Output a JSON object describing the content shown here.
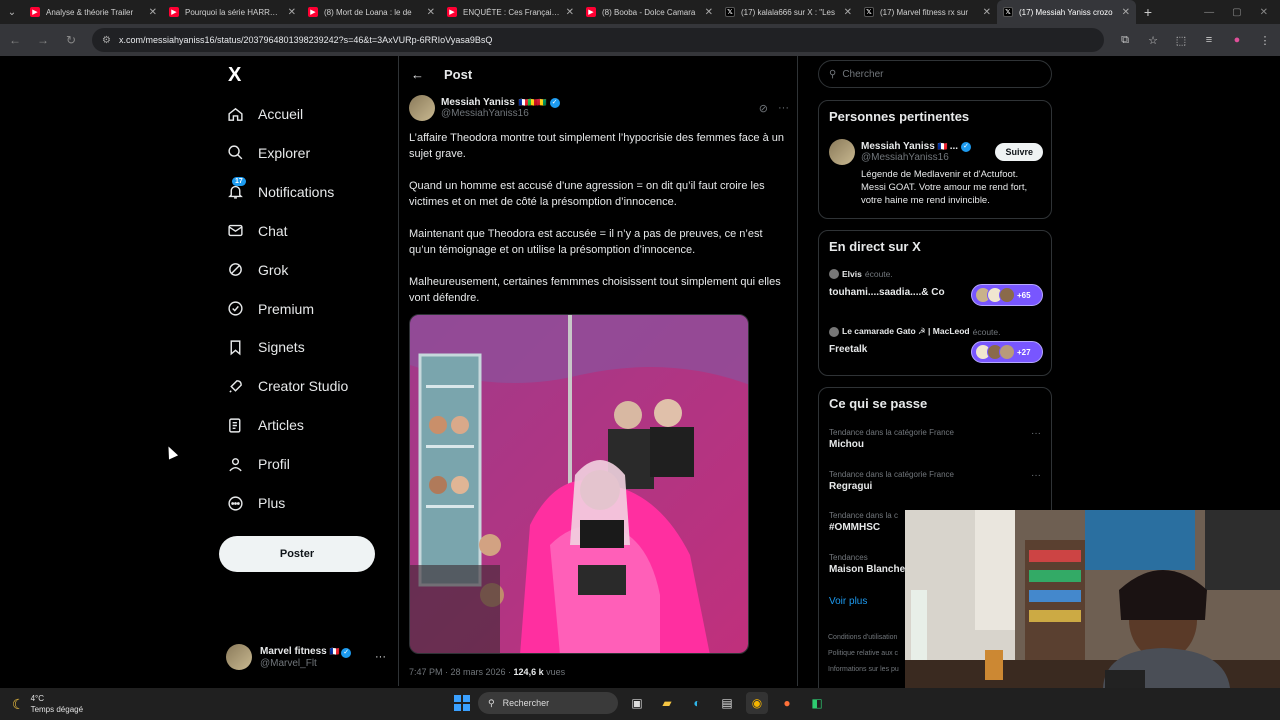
{
  "browser": {
    "tabs": [
      {
        "title": "Analyse & théorie Trailer",
        "type": "yt"
      },
      {
        "title": "Pourquoi la série HARRY P",
        "type": "yt"
      },
      {
        "title": "(8) Mort de Loana : le de",
        "type": "yt"
      },
      {
        "title": "ENQUÊTE : Ces Français p",
        "type": "yt"
      },
      {
        "title": "(8) Booba - Dolce Camara",
        "type": "yt"
      },
      {
        "title": "(17) kalala666 sur X : \"Les",
        "type": "x"
      },
      {
        "title": "(17) Marvel fitness rx sur",
        "type": "x"
      },
      {
        "title": "(17) Messiah Yaniss crozo",
        "type": "x",
        "active": true
      }
    ],
    "url": "x.com/messiahyaniss16/status/2037964801398239242?s=46&t=3AxVURp-6RRIoVyasa9BsQ"
  },
  "nav": {
    "logo": "X",
    "items": [
      {
        "label": "Accueil",
        "icon": "home-icon"
      },
      {
        "label": "Explorer",
        "icon": "search-icon"
      },
      {
        "label": "Notifications",
        "icon": "bell-icon",
        "badge": "17"
      },
      {
        "label": "Chat",
        "icon": "mail-icon"
      },
      {
        "label": "Grok",
        "icon": "grok-icon"
      },
      {
        "label": "Premium",
        "icon": "premium-icon"
      },
      {
        "label": "Signets",
        "icon": "bookmark-icon"
      },
      {
        "label": "Creator Studio",
        "icon": "rocket-icon"
      },
      {
        "label": "Articles",
        "icon": "articles-icon"
      },
      {
        "label": "Profil",
        "icon": "profile-icon"
      },
      {
        "label": "Plus",
        "icon": "more-circle-icon"
      }
    ],
    "post_button": "Poster",
    "account": {
      "name": "Marvel fitness",
      "handle": "@Marvel_Flt"
    }
  },
  "main": {
    "title": "Post",
    "author": {
      "name": "Messiah Yaniss",
      "handle": "@MessiahYaniss16"
    },
    "paragraphs": [
      "L’affaire Theodora montre tout simplement l’hypocrisie des femmes face à un sujet grave.",
      "Quand un homme est accusé d’une agression = on dit qu’il faut croire les victimes et on met de côté la présomption d’innocence.",
      "Maintenant que Theodora est accusée = il n’y a pas de preuves, ce n’est qu’un témoignage et on utilise la présomption d’innocence.",
      "Malheureusement, certaines femmmes choisissent tout simplement qui elles vont défendre."
    ],
    "meta_time": "7:47 PM · 28 mars 2026 · ",
    "meta_views": "124,6 k",
    "meta_views_label": " vues"
  },
  "right": {
    "search_placeholder": "Chercher",
    "relevant": {
      "title": "Personnes pertinentes",
      "name": "Messiah Yaniss",
      "name_suffix": " ...",
      "handle": "@MessiahYaniss16",
      "follow": "Suivre",
      "bio": "Légende de Medlavenir et d'Actufoot. Messi GOAT. Votre amour me rend fort, votre haine me rend invincible."
    },
    "live": {
      "title": "En direct sur X",
      "spaces": [
        {
          "host": "Elvis",
          "action": " écoute.",
          "title": "touhami....saadia....& Co",
          "count": "+65"
        },
        {
          "host": "Le camarade Gato ☭ | MacLeod",
          "action": " écoute.",
          "title": "Freetalk",
          "count": "+27"
        }
      ]
    },
    "trends": {
      "title": "Ce qui se passe",
      "items": [
        {
          "context": "Tendance dans la catégorie France",
          "name": "Michou"
        },
        {
          "context": "Tendance dans la catégorie France",
          "name": "Regragui"
        },
        {
          "context": "Tendance dans la c",
          "name": "#OMMHSC"
        },
        {
          "context": "Tendances",
          "name": "Maison Blanche"
        }
      ],
      "show_more": "Voir plus"
    },
    "legal": [
      "Conditions d'utilisation",
      "Politique relative aux c",
      "Informations sur les pu"
    ]
  },
  "taskbar": {
    "temp": "4°C",
    "weather": "Temps dégagé",
    "search": "Rechercher"
  },
  "colors": {
    "accent": "#1d9bf0",
    "background": "#000000",
    "border": "#2f3336",
    "muted": "#71767b"
  }
}
